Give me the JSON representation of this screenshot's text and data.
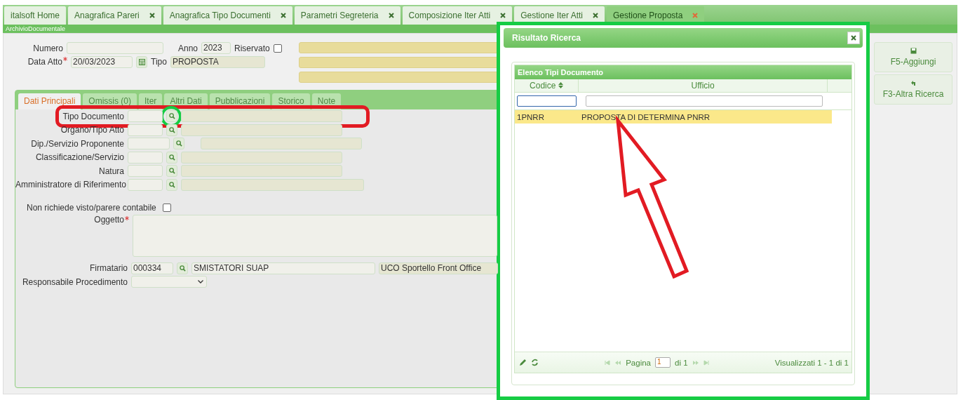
{
  "tabs": [
    {
      "label": "italsoft Home",
      "closable": false,
      "selected": false
    },
    {
      "label": "Anagrafica Pareri",
      "closable": true,
      "selected": false
    },
    {
      "label": "Anagrafica Tipo Documenti",
      "closable": true,
      "selected": false
    },
    {
      "label": "Parametri Segreteria",
      "closable": true,
      "selected": false
    },
    {
      "label": "Composizione Iter Atti",
      "closable": true,
      "selected": false
    },
    {
      "label": "Gestione Iter Atti",
      "closable": true,
      "selected": false
    },
    {
      "label": "Gestione Proposta",
      "closable": true,
      "selected": true
    }
  ],
  "module_bar": "ArchivioDocumentale",
  "header": {
    "numero_label": "Numero",
    "anno_label": "Anno",
    "anno_value": "2023",
    "riservato_label": "Riservato",
    "riservato_checked": false,
    "data_label": "Data Atto",
    "data_required": true,
    "data_value": "20/03/2023",
    "tipo_label": "Tipo",
    "tipo_value": "PROPOSTA"
  },
  "actions": [
    "F5-Aggiungi",
    "F3-Altra Ricerca"
  ],
  "section_tabs": [
    {
      "label": "Dati Principali",
      "selected": true
    },
    {
      "label": "Omissis (0)",
      "selected": false
    },
    {
      "label": "Iter",
      "selected": false
    },
    {
      "label": "Altri Dati",
      "selected": false
    },
    {
      "label": "Pubblicazioni",
      "selected": false
    },
    {
      "label": "Storico",
      "selected": false
    },
    {
      "label": "Note",
      "selected": false
    }
  ],
  "lookup_fields": [
    {
      "label": "Tipo Documento"
    },
    {
      "label": "Organo/Tipo Atto"
    },
    {
      "label": "Dip./Servizio Proponente"
    },
    {
      "label": "Classificazione/Servizio"
    },
    {
      "label": "Natura"
    },
    {
      "label": "Amministratore di Riferimento"
    }
  ],
  "contabile": {
    "label": "Non richiede visto/parere contabile",
    "checked": false
  },
  "oggetto": {
    "label": "Oggetto",
    "required": true
  },
  "firmatario": {
    "label": "Firmatario",
    "code": "000334",
    "name": "SMISTATORI SUAP",
    "office": "UCO Sportello Front Office"
  },
  "responsabile_label": "Responsabile Procedimento",
  "dialog": {
    "title": "Risultato Ricerca",
    "grid_title": "Elenco Tipi Documento",
    "columns": [
      "Codice",
      "Ufficio"
    ],
    "rows": [
      {
        "cells": [
          "1PNRR",
          "PROPOSTA DI DETERMINA PNRR"
        ],
        "selected": true
      }
    ],
    "pager": {
      "page_label": "Pagina",
      "page": "1",
      "of": "di 1",
      "summary": "Visualizzati 1 - 1 di 1"
    }
  }
}
